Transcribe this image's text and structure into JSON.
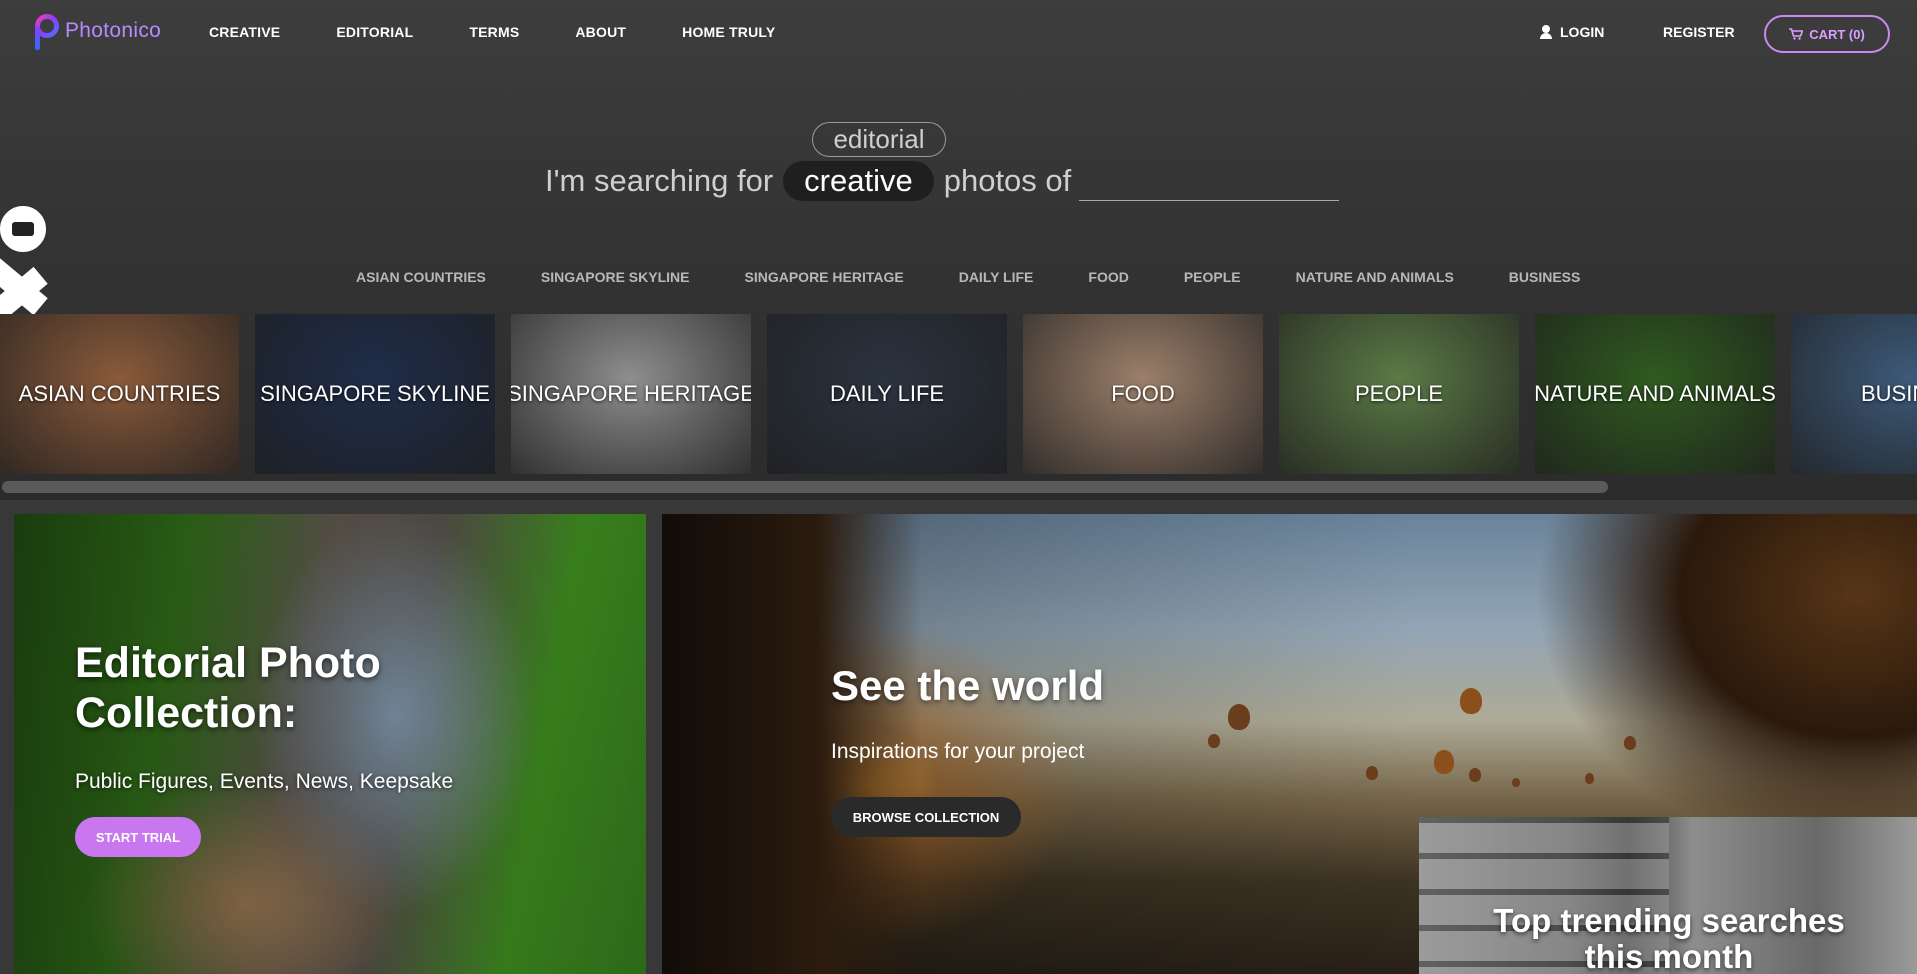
{
  "header": {
    "logo_text": "Photonico",
    "nav_left": [
      "CREATIVE",
      "EDITORIAL",
      "TERMS",
      "ABOUT",
      "HOME TRULY"
    ],
    "login": "LOGIN",
    "register": "REGISTER",
    "cart": "CART (0)",
    "accent_color": "#c88af0"
  },
  "search": {
    "prefix": "I'm searching for",
    "option_editorial": "editorial",
    "option_creative": "creative",
    "suffix": "photos of",
    "input_value": ""
  },
  "categories": {
    "links": [
      "ASIAN COUNTRIES",
      "SINGAPORE SKYLINE",
      "SINGAPORE HERITAGE",
      "DAILY LIFE",
      "FOOD",
      "PEOPLE",
      "NATURE AND ANIMALS",
      "BUSINESS"
    ],
    "tiles": [
      {
        "label": "ASIAN COUNTRIES",
        "color": "#8a5a3a"
      },
      {
        "label": "SINGAPORE SKYLINE",
        "color": "#1f2d4a"
      },
      {
        "label": "SINGAPORE HERITAGE",
        "color": "#8e8e8e"
      },
      {
        "label": "DAILY LIFE",
        "color": "#2b3340"
      },
      {
        "label": "FOOD",
        "color": "#9b7f6a"
      },
      {
        "label": "PEOPLE",
        "color": "#5b7a45"
      },
      {
        "label": "NATURE AND ANIMALS",
        "color": "#2f5a1f"
      },
      {
        "label": "BUSINESS",
        "color": "#3d5a7a"
      }
    ]
  },
  "banners": {
    "left": {
      "title": "Editorial Photo Collection:",
      "subtitle": "Public Figures, Events, News, Keepsake",
      "button": "START TRIAL"
    },
    "right": {
      "title": "See the world",
      "subtitle": "Inspirations for your project",
      "button": "BROWSE COLLECTION"
    },
    "trending": {
      "title": "Top trending searches this month"
    }
  }
}
